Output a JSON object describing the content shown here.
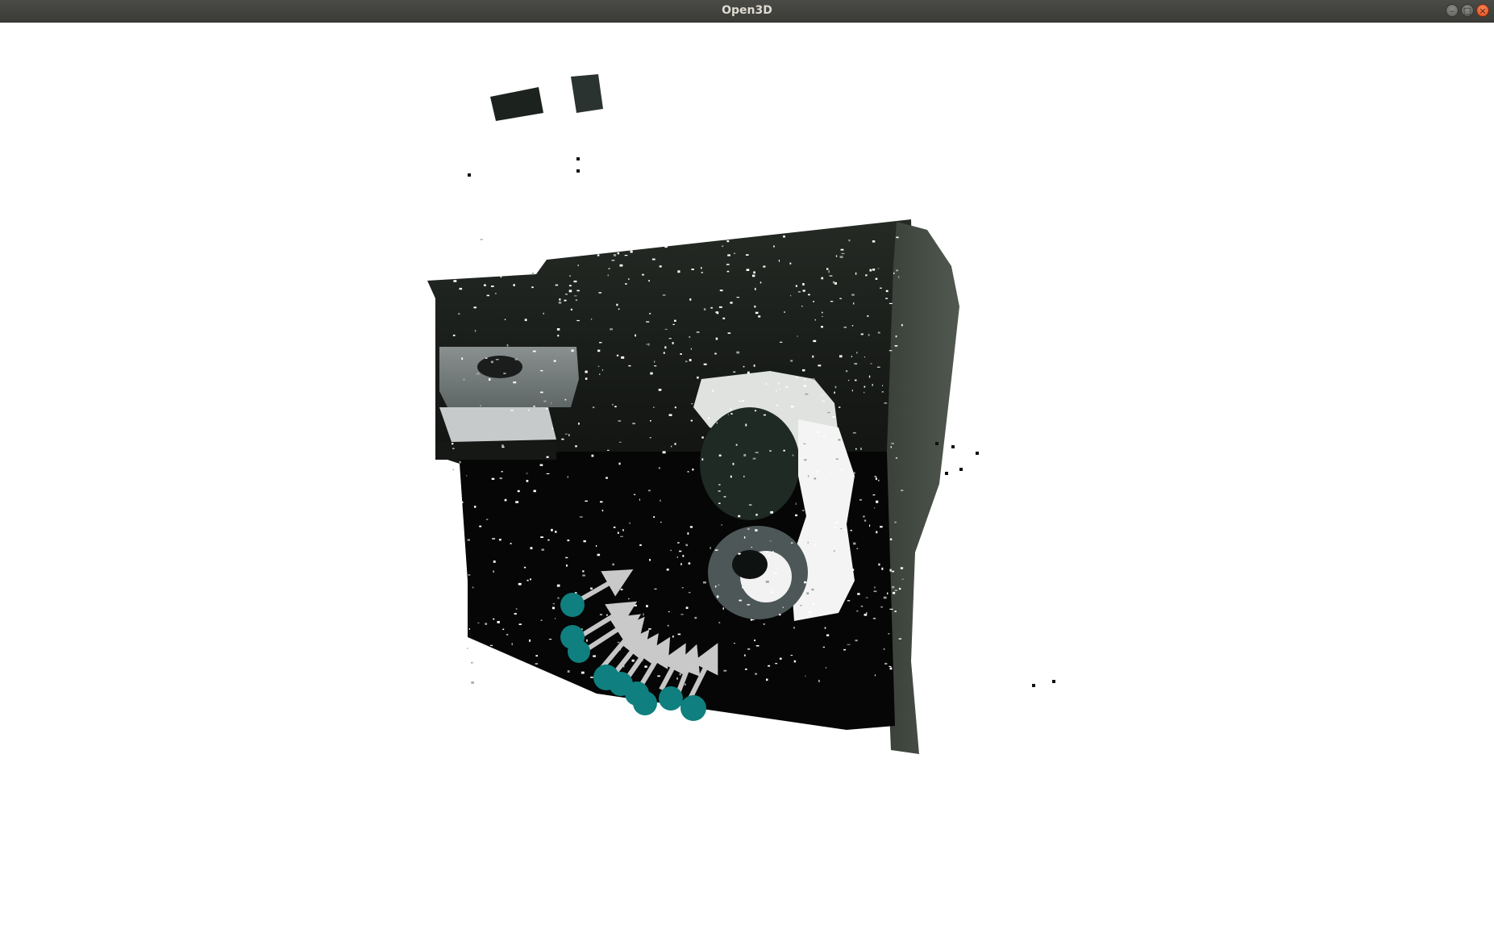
{
  "window": {
    "title": "Open3D"
  },
  "controls": {
    "minimize_icon": "minimize-icon",
    "maximize_icon": "maximize-icon",
    "close_icon": "close-icon",
    "minimize_glyph": "–",
    "maximize_glyph": "□",
    "close_glyph": "×"
  },
  "colors": {
    "titlebar": "#3f3f3c",
    "background": "#ffffff",
    "point_cloud_dark": "#0b0d0b",
    "wall_shade": "#262b26",
    "keypoint_sphere": "#0f7f7f",
    "normal_arrow": "#c6c6c6"
  }
}
